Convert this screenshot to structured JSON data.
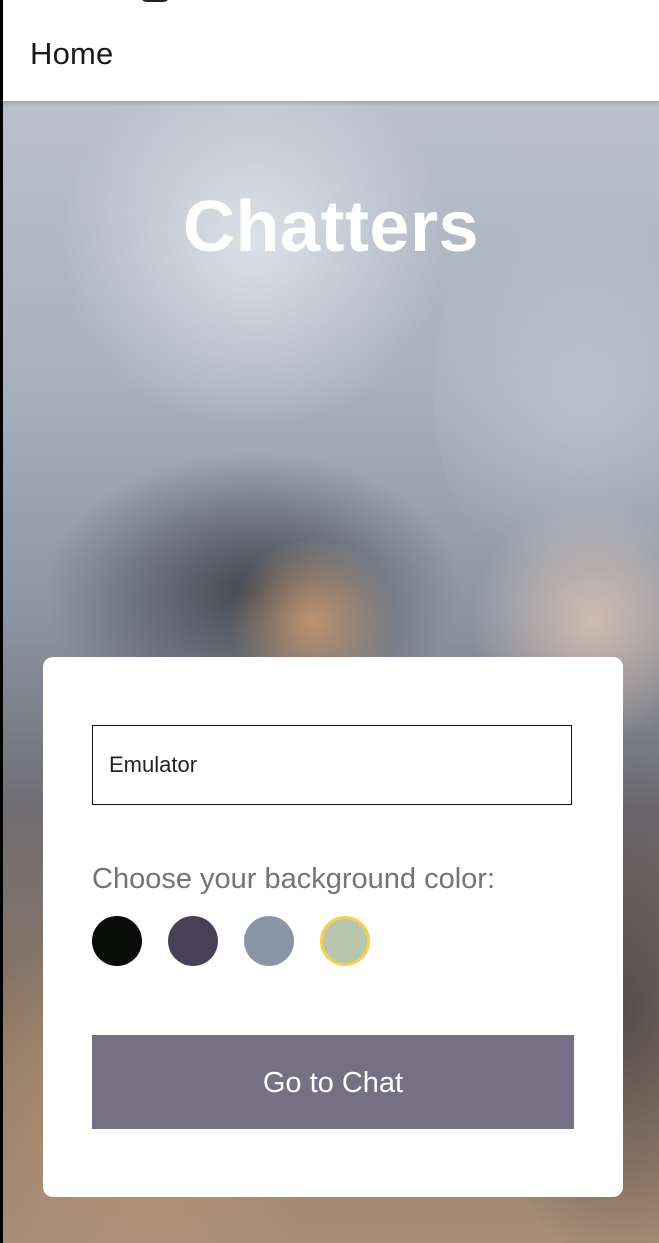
{
  "app_bar": {
    "title": "Home"
  },
  "hero": {
    "title": "Chatters"
  },
  "form": {
    "name_input": {
      "value": "Emulator",
      "placeholder": ""
    },
    "color_prompt": "Choose your background color:",
    "colors": [
      "#090C08",
      "#474056",
      "#8A95A5",
      "#B9C6AE"
    ],
    "selected_color_index": 3,
    "selected_ring_color": "#F5D04E",
    "button_label": "Go to Chat",
    "button_color": "#757083"
  }
}
